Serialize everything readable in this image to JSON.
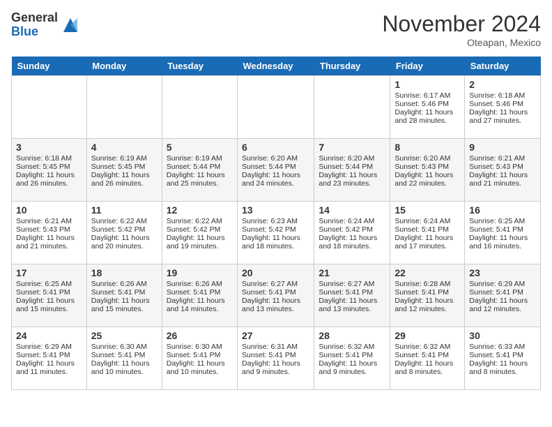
{
  "header": {
    "logo_general": "General",
    "logo_blue": "Blue",
    "month_title": "November 2024",
    "location": "Oteapan, Mexico"
  },
  "days_of_week": [
    "Sunday",
    "Monday",
    "Tuesday",
    "Wednesday",
    "Thursday",
    "Friday",
    "Saturday"
  ],
  "weeks": [
    [
      {
        "day": "",
        "sunrise": "",
        "sunset": "",
        "daylight": ""
      },
      {
        "day": "",
        "sunrise": "",
        "sunset": "",
        "daylight": ""
      },
      {
        "day": "",
        "sunrise": "",
        "sunset": "",
        "daylight": ""
      },
      {
        "day": "",
        "sunrise": "",
        "sunset": "",
        "daylight": ""
      },
      {
        "day": "",
        "sunrise": "",
        "sunset": "",
        "daylight": ""
      },
      {
        "day": "1",
        "sunrise": "Sunrise: 6:17 AM",
        "sunset": "Sunset: 5:46 PM",
        "daylight": "Daylight: 11 hours and 28 minutes."
      },
      {
        "day": "2",
        "sunrise": "Sunrise: 6:18 AM",
        "sunset": "Sunset: 5:46 PM",
        "daylight": "Daylight: 11 hours and 27 minutes."
      }
    ],
    [
      {
        "day": "3",
        "sunrise": "Sunrise: 6:18 AM",
        "sunset": "Sunset: 5:45 PM",
        "daylight": "Daylight: 11 hours and 26 minutes."
      },
      {
        "day": "4",
        "sunrise": "Sunrise: 6:19 AM",
        "sunset": "Sunset: 5:45 PM",
        "daylight": "Daylight: 11 hours and 26 minutes."
      },
      {
        "day": "5",
        "sunrise": "Sunrise: 6:19 AM",
        "sunset": "Sunset: 5:44 PM",
        "daylight": "Daylight: 11 hours and 25 minutes."
      },
      {
        "day": "6",
        "sunrise": "Sunrise: 6:20 AM",
        "sunset": "Sunset: 5:44 PM",
        "daylight": "Daylight: 11 hours and 24 minutes."
      },
      {
        "day": "7",
        "sunrise": "Sunrise: 6:20 AM",
        "sunset": "Sunset: 5:44 PM",
        "daylight": "Daylight: 11 hours and 23 minutes."
      },
      {
        "day": "8",
        "sunrise": "Sunrise: 6:20 AM",
        "sunset": "Sunset: 5:43 PM",
        "daylight": "Daylight: 11 hours and 22 minutes."
      },
      {
        "day": "9",
        "sunrise": "Sunrise: 6:21 AM",
        "sunset": "Sunset: 5:43 PM",
        "daylight": "Daylight: 11 hours and 21 minutes."
      }
    ],
    [
      {
        "day": "10",
        "sunrise": "Sunrise: 6:21 AM",
        "sunset": "Sunset: 5:43 PM",
        "daylight": "Daylight: 11 hours and 21 minutes."
      },
      {
        "day": "11",
        "sunrise": "Sunrise: 6:22 AM",
        "sunset": "Sunset: 5:42 PM",
        "daylight": "Daylight: 11 hours and 20 minutes."
      },
      {
        "day": "12",
        "sunrise": "Sunrise: 6:22 AM",
        "sunset": "Sunset: 5:42 PM",
        "daylight": "Daylight: 11 hours and 19 minutes."
      },
      {
        "day": "13",
        "sunrise": "Sunrise: 6:23 AM",
        "sunset": "Sunset: 5:42 PM",
        "daylight": "Daylight: 11 hours and 18 minutes."
      },
      {
        "day": "14",
        "sunrise": "Sunrise: 6:24 AM",
        "sunset": "Sunset: 5:42 PM",
        "daylight": "Daylight: 11 hours and 18 minutes."
      },
      {
        "day": "15",
        "sunrise": "Sunrise: 6:24 AM",
        "sunset": "Sunset: 5:41 PM",
        "daylight": "Daylight: 11 hours and 17 minutes."
      },
      {
        "day": "16",
        "sunrise": "Sunrise: 6:25 AM",
        "sunset": "Sunset: 5:41 PM",
        "daylight": "Daylight: 11 hours and 16 minutes."
      }
    ],
    [
      {
        "day": "17",
        "sunrise": "Sunrise: 6:25 AM",
        "sunset": "Sunset: 5:41 PM",
        "daylight": "Daylight: 11 hours and 15 minutes."
      },
      {
        "day": "18",
        "sunrise": "Sunrise: 6:26 AM",
        "sunset": "Sunset: 5:41 PM",
        "daylight": "Daylight: 11 hours and 15 minutes."
      },
      {
        "day": "19",
        "sunrise": "Sunrise: 6:26 AM",
        "sunset": "Sunset: 5:41 PM",
        "daylight": "Daylight: 11 hours and 14 minutes."
      },
      {
        "day": "20",
        "sunrise": "Sunrise: 6:27 AM",
        "sunset": "Sunset: 5:41 PM",
        "daylight": "Daylight: 11 hours and 13 minutes."
      },
      {
        "day": "21",
        "sunrise": "Sunrise: 6:27 AM",
        "sunset": "Sunset: 5:41 PM",
        "daylight": "Daylight: 11 hours and 13 minutes."
      },
      {
        "day": "22",
        "sunrise": "Sunrise: 6:28 AM",
        "sunset": "Sunset: 5:41 PM",
        "daylight": "Daylight: 11 hours and 12 minutes."
      },
      {
        "day": "23",
        "sunrise": "Sunrise: 6:29 AM",
        "sunset": "Sunset: 5:41 PM",
        "daylight": "Daylight: 11 hours and 12 minutes."
      }
    ],
    [
      {
        "day": "24",
        "sunrise": "Sunrise: 6:29 AM",
        "sunset": "Sunset: 5:41 PM",
        "daylight": "Daylight: 11 hours and 11 minutes."
      },
      {
        "day": "25",
        "sunrise": "Sunrise: 6:30 AM",
        "sunset": "Sunset: 5:41 PM",
        "daylight": "Daylight: 11 hours and 10 minutes."
      },
      {
        "day": "26",
        "sunrise": "Sunrise: 6:30 AM",
        "sunset": "Sunset: 5:41 PM",
        "daylight": "Daylight: 11 hours and 10 minutes."
      },
      {
        "day": "27",
        "sunrise": "Sunrise: 6:31 AM",
        "sunset": "Sunset: 5:41 PM",
        "daylight": "Daylight: 11 hours and 9 minutes."
      },
      {
        "day": "28",
        "sunrise": "Sunrise: 6:32 AM",
        "sunset": "Sunset: 5:41 PM",
        "daylight": "Daylight: 11 hours and 9 minutes."
      },
      {
        "day": "29",
        "sunrise": "Sunrise: 6:32 AM",
        "sunset": "Sunset: 5:41 PM",
        "daylight": "Daylight: 11 hours and 8 minutes."
      },
      {
        "day": "30",
        "sunrise": "Sunrise: 6:33 AM",
        "sunset": "Sunset: 5:41 PM",
        "daylight": "Daylight: 11 hours and 8 minutes."
      }
    ]
  ]
}
